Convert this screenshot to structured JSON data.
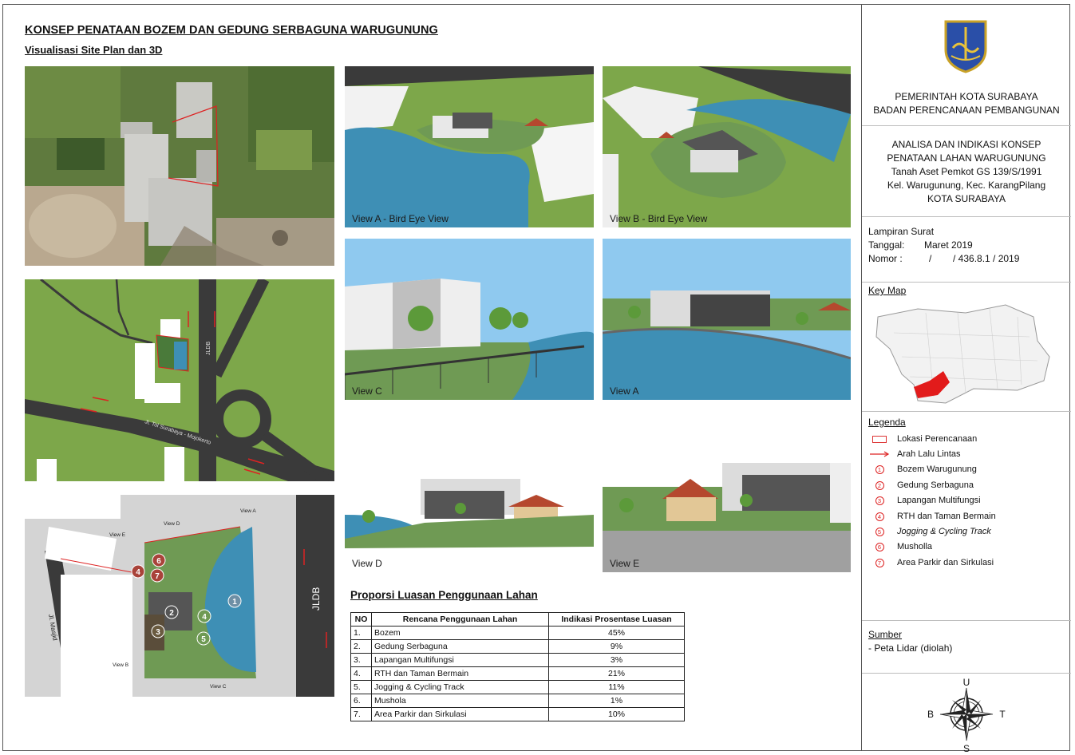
{
  "header": {
    "title": "KONSEP PENATAAN BOZEM DAN GEDUNG SERBAGUNA WARUGUNUNG",
    "subtitle": "Visualisasi Site Plan dan 3D"
  },
  "map": {
    "road_label": "Jl. Tol Surabaya - Mojokerto",
    "jldb": "JLDB",
    "jl_masjid": "Jl. Masjid",
    "view_markers": [
      "View A",
      "View B",
      "View C",
      "View D",
      "View E"
    ],
    "numbers": [
      "1",
      "2",
      "3",
      "4",
      "5",
      "6",
      "7",
      "4"
    ]
  },
  "views": [
    {
      "label": "View A - Bird Eye View"
    },
    {
      "label": "View B - Bird Eye View"
    },
    {
      "label": "View C"
    },
    {
      "label": "View A"
    },
    {
      "label": "View D"
    },
    {
      "label": "View E"
    }
  ],
  "table": {
    "title": "Proporsi Luasan Penggunaan Lahan",
    "headers": [
      "NO",
      "Rencana Penggunaan Lahan",
      "Indikasi Prosentase Luasan"
    ],
    "rows": [
      {
        "no": "1.",
        "name": "Bozem",
        "pct": "45%"
      },
      {
        "no": "2.",
        "name": "Gedung Serbaguna",
        "pct": "9%"
      },
      {
        "no": "3.",
        "name": "Lapangan Multifungsi",
        "pct": "3%"
      },
      {
        "no": "4.",
        "name": "RTH dan Taman Bermain",
        "pct": "21%"
      },
      {
        "no": "5.",
        "name": "Jogging & Cycling Track",
        "pct": "11%"
      },
      {
        "no": "6.",
        "name": "Mushola",
        "pct": "1%"
      },
      {
        "no": "7.",
        "name": "Area Parkir dan Sirkulasi",
        "pct": "10%"
      }
    ]
  },
  "sidebar": {
    "gov_line1": "PEMERINTAH KOTA SURABAYA",
    "gov_line2": "BADAN PERENCANAAN PEMBANGUNAN",
    "project": {
      "line1": "ANALISA DAN INDIKASI KONSEP",
      "line2": "PENATAAN LAHAN WARUGUNUNG",
      "line3": "Tanah Aset Pemkot GS 139/S/1991",
      "line4": "Kel. Warugunung, Kec. KarangPilang",
      "line5": "KOTA SURABAYA"
    },
    "lampiran": {
      "heading": "Lampiran Surat",
      "tanggal_label": "Tanggal:",
      "tanggal_value": "Maret 2019",
      "nomor_label": "Nomor :",
      "nomor_value": "/        / 436.8.1 / 2019"
    },
    "keymap_title": "Key Map",
    "legend_title": "Legenda",
    "legend": [
      {
        "sym": "",
        "label": "Lokasi Perencanaan"
      },
      {
        "sym": "",
        "label": "Arah Lalu Lintas"
      },
      {
        "sym": "1",
        "label": "Bozem Warugunung"
      },
      {
        "sym": "2",
        "label": "Gedung Serbaguna"
      },
      {
        "sym": "3",
        "label": "Lapangan Multifungsi"
      },
      {
        "sym": "4",
        "label": "RTH dan Taman Bermain"
      },
      {
        "sym": "5",
        "label": "Jogging & Cycling Track"
      },
      {
        "sym": "6",
        "label": "Musholla"
      },
      {
        "sym": "7",
        "label": "Area Parkir dan Sirkulasi"
      }
    ],
    "sumber_title": "Sumber",
    "sumber_text": "- Peta Lidar (diolah)",
    "compass": {
      "n": "U",
      "s": "S",
      "e": "T",
      "w": "B"
    }
  },
  "colors": {
    "grass": "#7da74a",
    "water": "#3e8fb5",
    "road": "#3a3a3a",
    "accent_red": "#d22222",
    "sky": "#8fc9ef"
  },
  "icons": [
    "surabaya-emblem-icon",
    "compass-rose-icon",
    "arrow-right-icon"
  ]
}
